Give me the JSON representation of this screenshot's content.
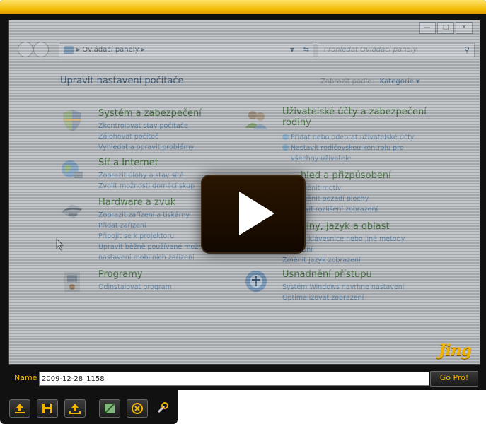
{
  "capture": {
    "window_controls": [
      "minimize",
      "maximize",
      "close"
    ],
    "address_bar": {
      "path": "Ovládací panely"
    },
    "search": {
      "placeholder": "Prohledat Ovládací panely"
    },
    "heading": "Upravit nastavení počítače",
    "view_by": {
      "label": "Zobrazit podle:",
      "value": "Kategorie"
    },
    "categories": [
      {
        "title": "Systém a zabezpečení",
        "icon": "shield-icon",
        "links": [
          "Zkontrolovat stav počítače",
          "Zálohovat počítač",
          "Vyhledat a opravit problémy"
        ]
      },
      {
        "title": "Síť a Internet",
        "icon": "network-globe-icon",
        "links": [
          "Zobrazit úlohy a stav sítě",
          "Zvolit možnosti domácí skup"
        ]
      },
      {
        "title": "Hardware a zvuk",
        "icon": "printer-icon",
        "links": [
          "Zobrazit zařízení a tiskárny",
          "Přidat zařízení",
          "Připojit se k projektoru",
          "Upravit běžně používané možnosti",
          "nastavení mobilních zařízení"
        ]
      },
      {
        "title": "Programy",
        "icon": "programs-icon",
        "links": [
          "Odinstalovat program"
        ]
      },
      {
        "title": "Uživatelské účty a zabezpečení",
        "title2": "rodiny",
        "icon": "users-icon",
        "links": [
          "Přidat nebo odebrat uživatelské účty",
          "Nastavit rodičovskou kontrolu pro",
          "všechny uživatele"
        ]
      },
      {
        "title": "hled a přizpůsobení",
        "icon": "appearance-icon",
        "links": [
          "měnit motiv",
          "měnit pozadí plochy",
          "avit rozlišení zobrazení"
        ]
      },
      {
        "title": "diny, jazyk a oblast",
        "icon": "clock-icon",
        "links": [
          "Změnit klávesnice nebo jiné metody",
          "zadávání",
          "Změnit jazyk zobrazení"
        ]
      },
      {
        "title": "Usnadnění přístupu",
        "icon": "ease-of-access-icon",
        "links": [
          "Systém Windows navrhne nastavení",
          "Optimalizovat zobrazení"
        ]
      }
    ]
  },
  "jing": {
    "logo": "Jing",
    "name_label": "Name",
    "name_value": "2009-12-28_1158",
    "go_pro_label": "Go Pro!",
    "toolbar_buttons": [
      "share-screencast-icon",
      "save-icon",
      "share-icon",
      "copy-icon",
      "cancel-icon",
      "tools-icon"
    ],
    "accent_color": "#f0b400"
  }
}
